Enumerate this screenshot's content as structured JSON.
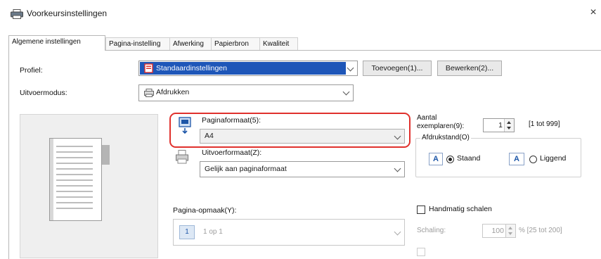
{
  "window": {
    "title": "Voorkeursinstellingen",
    "close_glyph": "×"
  },
  "tabs": [
    {
      "label": "Algemene instellingen",
      "active": true
    },
    {
      "label": "Pagina-instelling",
      "active": false
    },
    {
      "label": "Afwerking",
      "active": false
    },
    {
      "label": "Papierbron",
      "active": false
    },
    {
      "label": "Kwaliteit",
      "active": false
    }
  ],
  "profile": {
    "label": "Profiel:",
    "value": "Standaardinstellingen",
    "add_button": "Toevoegen(1)...",
    "edit_button": "Bewerken(2)..."
  },
  "output_mode": {
    "label": "Uitvoermodus:",
    "value": "Afdrukken"
  },
  "page_size": {
    "label": "Paginaformaat(5):",
    "value": "A4"
  },
  "output_size": {
    "label": "Uitvoerformaat(Z):",
    "value": "Gelijk aan paginaformaat"
  },
  "copies": {
    "label_line1": "Aantal",
    "label_line2": "exemplaren(9):",
    "value": "1",
    "range": "[1 tot 999]"
  },
  "orientation": {
    "group_label": "Afdrukstand(O)",
    "portrait_label": "Staand",
    "landscape_label": "Liggend",
    "icon_letter": "A",
    "selected": "portrait"
  },
  "page_layout": {
    "label": "Pagina-opmaak(Y):",
    "value": "1 op 1",
    "icon_number": "1"
  },
  "manual_scaling": {
    "label": "Handmatig schalen",
    "checked": false
  },
  "scaling": {
    "label": "Schaling:",
    "value": "100",
    "range": "% [25 tot 200]"
  },
  "colors": {
    "highlight": "#e0312d",
    "profile_fill": "#1e56b8",
    "icon_blue": "#1d56a8"
  },
  "icons": {
    "title": "printer-icon",
    "profile": "profile-icon",
    "output_mode": "printer-icon",
    "page_size": "page-size-icon",
    "output_size": "output-size-icon"
  }
}
